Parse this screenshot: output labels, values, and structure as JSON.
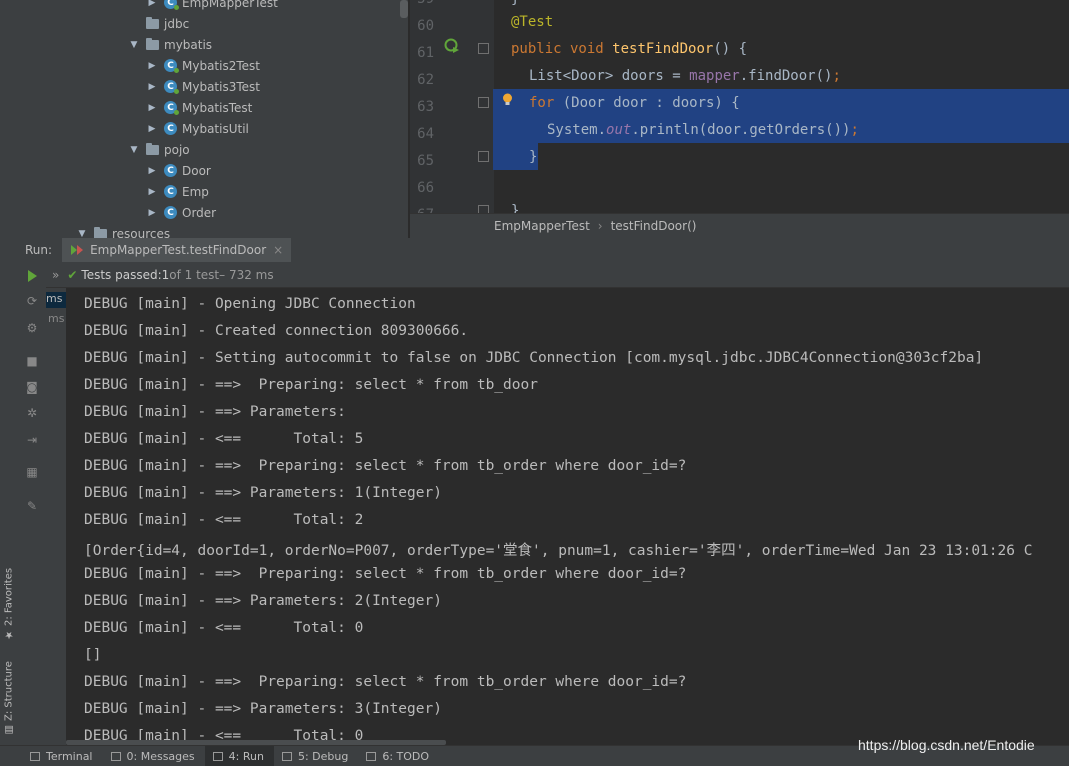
{
  "tree": {
    "items": [
      {
        "label": "EmpMapperTest",
        "type": "class-test",
        "level": 3,
        "arrow": "▶"
      },
      {
        "label": "jdbc",
        "type": "folder",
        "level": 2,
        "arrow": ""
      },
      {
        "label": "mybatis",
        "type": "folder",
        "level": 2,
        "arrow": "▼"
      },
      {
        "label": "Mybatis2Test",
        "type": "class-test",
        "level": 3,
        "arrow": "▶"
      },
      {
        "label": "Mybatis3Test",
        "type": "class-test",
        "level": 3,
        "arrow": "▶"
      },
      {
        "label": "MybatisTest",
        "type": "class-test",
        "level": 3,
        "arrow": "▶"
      },
      {
        "label": "MybatisUtil",
        "type": "class",
        "level": 3,
        "arrow": "▶"
      },
      {
        "label": "pojo",
        "type": "folder",
        "level": 2,
        "arrow": "▼"
      },
      {
        "label": "Door",
        "type": "class",
        "level": 3,
        "arrow": "▶"
      },
      {
        "label": "Emp",
        "type": "class",
        "level": 3,
        "arrow": "▶"
      },
      {
        "label": "Order",
        "type": "class",
        "level": 3,
        "arrow": "▶"
      },
      {
        "label": "resources",
        "type": "folder",
        "level": 1,
        "arrow": "▼"
      }
    ],
    "class_letter": "C"
  },
  "editor": {
    "line_numbers": [
      "59",
      "60",
      "61",
      "62",
      "63",
      "64",
      "65",
      "66",
      "67"
    ],
    "lines": {
      "l59": "}",
      "l60_ann": "@Test",
      "l61_kw": "public void ",
      "l61_fn": "testFindDoor",
      "l61_rest": "() {",
      "l62_a": "List<Door> doors = ",
      "l62_fld": "mapper",
      "l62_b": ".findDoor()",
      "l62_semi": ";",
      "l63_kw": "for ",
      "l63_rest": "(Door door : doors) {",
      "l64_a": "System.",
      "l64_fld": "out",
      "l64_b": ".println(door.getOrders())",
      "l64_semi": ";",
      "l65": "}",
      "l67": "}"
    }
  },
  "breadcrumb": {
    "class": "EmpMapperTest",
    "sep": "›",
    "method": "testFindDoor()"
  },
  "run": {
    "label": "Run:",
    "tab": "EmpMapperTest.testFindDoor",
    "tab_close": "×",
    "expand": "»",
    "status_prefix": "Tests passed: ",
    "status_count": "1",
    "status_rest": " of 1 test",
    "status_time": " – 732 ms",
    "ms1": "ms",
    "ms2": "ms"
  },
  "console": [
    "DEBUG [main] - Opening JDBC Connection",
    "DEBUG [main] - Created connection 809300666.",
    "DEBUG [main] - Setting autocommit to false on JDBC Connection [com.mysql.jdbc.JDBC4Connection@303cf2ba]",
    "DEBUG [main] - ==>  Preparing: select * from tb_door",
    "DEBUG [main] - ==> Parameters: ",
    "DEBUG [main] - <==      Total: 5",
    "DEBUG [main] - ==>  Preparing: select * from tb_order where door_id=?",
    "DEBUG [main] - ==> Parameters: 1(Integer)",
    "DEBUG [main] - <==      Total: 2",
    "[Order{id=4, doorId=1, orderNo=P007, orderType='堂食', pnum=1, cashier='李四', orderTime=Wed Jan 23 13:01:26 C",
    "DEBUG [main] - ==>  Preparing: select * from tb_order where door_id=?",
    "DEBUG [main] - ==> Parameters: 2(Integer)",
    "DEBUG [main] - <==      Total: 0",
    "[]",
    "DEBUG [main] - ==>  Preparing: select * from tb_order where door_id=?",
    "DEBUG [main] - ==> Parameters: 3(Integer)",
    "DEBUG [main] - <==      Total: 0"
  ],
  "side_tabs": {
    "favorites": "2: Favorites",
    "structure": "Z: Structure"
  },
  "bottom_tabs": [
    {
      "label": "Terminal",
      "active": false
    },
    {
      "label": "0: Messages",
      "active": false
    },
    {
      "label": "4: Run",
      "active": true
    },
    {
      "label": "5: Debug",
      "active": false
    },
    {
      "label": "6: TODO",
      "active": false
    }
  ],
  "watermark": "https://blog.csdn.net/Entodie",
  "colors": {
    "selection": "#214283",
    "keyword": "#cc7832",
    "annotation": "#bbb529",
    "method": "#ffc66d",
    "field": "#9876aa",
    "pass": "#60a53a"
  }
}
